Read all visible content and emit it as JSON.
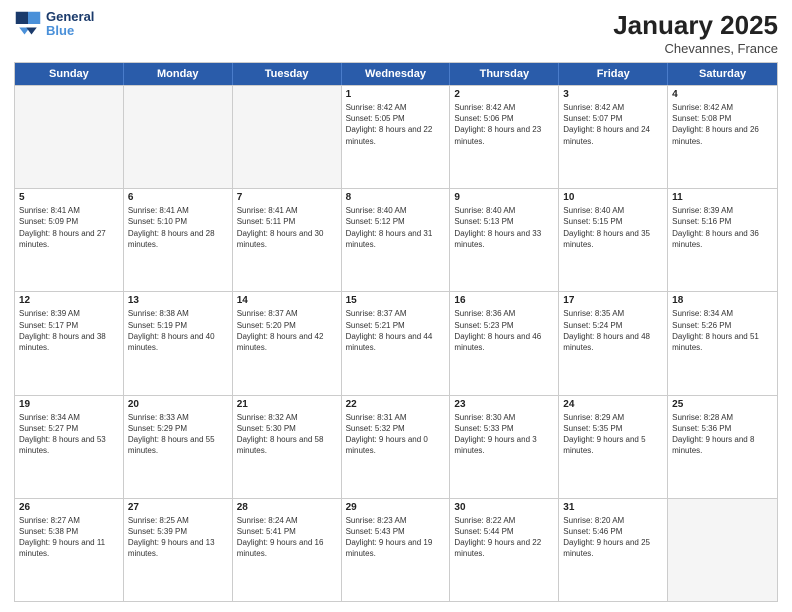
{
  "logo": {
    "line1": "General",
    "line2": "Blue"
  },
  "title": "January 2025",
  "location": "Chevannes, France",
  "days": [
    "Sunday",
    "Monday",
    "Tuesday",
    "Wednesday",
    "Thursday",
    "Friday",
    "Saturday"
  ],
  "weeks": [
    [
      {
        "day": "",
        "sunrise": "",
        "sunset": "",
        "daylight": ""
      },
      {
        "day": "",
        "sunrise": "",
        "sunset": "",
        "daylight": ""
      },
      {
        "day": "",
        "sunrise": "",
        "sunset": "",
        "daylight": ""
      },
      {
        "day": "1",
        "sunrise": "Sunrise: 8:42 AM",
        "sunset": "Sunset: 5:05 PM",
        "daylight": "Daylight: 8 hours and 22 minutes."
      },
      {
        "day": "2",
        "sunrise": "Sunrise: 8:42 AM",
        "sunset": "Sunset: 5:06 PM",
        "daylight": "Daylight: 8 hours and 23 minutes."
      },
      {
        "day": "3",
        "sunrise": "Sunrise: 8:42 AM",
        "sunset": "Sunset: 5:07 PM",
        "daylight": "Daylight: 8 hours and 24 minutes."
      },
      {
        "day": "4",
        "sunrise": "Sunrise: 8:42 AM",
        "sunset": "Sunset: 5:08 PM",
        "daylight": "Daylight: 8 hours and 26 minutes."
      }
    ],
    [
      {
        "day": "5",
        "sunrise": "Sunrise: 8:41 AM",
        "sunset": "Sunset: 5:09 PM",
        "daylight": "Daylight: 8 hours and 27 minutes."
      },
      {
        "day": "6",
        "sunrise": "Sunrise: 8:41 AM",
        "sunset": "Sunset: 5:10 PM",
        "daylight": "Daylight: 8 hours and 28 minutes."
      },
      {
        "day": "7",
        "sunrise": "Sunrise: 8:41 AM",
        "sunset": "Sunset: 5:11 PM",
        "daylight": "Daylight: 8 hours and 30 minutes."
      },
      {
        "day": "8",
        "sunrise": "Sunrise: 8:40 AM",
        "sunset": "Sunset: 5:12 PM",
        "daylight": "Daylight: 8 hours and 31 minutes."
      },
      {
        "day": "9",
        "sunrise": "Sunrise: 8:40 AM",
        "sunset": "Sunset: 5:13 PM",
        "daylight": "Daylight: 8 hours and 33 minutes."
      },
      {
        "day": "10",
        "sunrise": "Sunrise: 8:40 AM",
        "sunset": "Sunset: 5:15 PM",
        "daylight": "Daylight: 8 hours and 35 minutes."
      },
      {
        "day": "11",
        "sunrise": "Sunrise: 8:39 AM",
        "sunset": "Sunset: 5:16 PM",
        "daylight": "Daylight: 8 hours and 36 minutes."
      }
    ],
    [
      {
        "day": "12",
        "sunrise": "Sunrise: 8:39 AM",
        "sunset": "Sunset: 5:17 PM",
        "daylight": "Daylight: 8 hours and 38 minutes."
      },
      {
        "day": "13",
        "sunrise": "Sunrise: 8:38 AM",
        "sunset": "Sunset: 5:19 PM",
        "daylight": "Daylight: 8 hours and 40 minutes."
      },
      {
        "day": "14",
        "sunrise": "Sunrise: 8:37 AM",
        "sunset": "Sunset: 5:20 PM",
        "daylight": "Daylight: 8 hours and 42 minutes."
      },
      {
        "day": "15",
        "sunrise": "Sunrise: 8:37 AM",
        "sunset": "Sunset: 5:21 PM",
        "daylight": "Daylight: 8 hours and 44 minutes."
      },
      {
        "day": "16",
        "sunrise": "Sunrise: 8:36 AM",
        "sunset": "Sunset: 5:23 PM",
        "daylight": "Daylight: 8 hours and 46 minutes."
      },
      {
        "day": "17",
        "sunrise": "Sunrise: 8:35 AM",
        "sunset": "Sunset: 5:24 PM",
        "daylight": "Daylight: 8 hours and 48 minutes."
      },
      {
        "day": "18",
        "sunrise": "Sunrise: 8:34 AM",
        "sunset": "Sunset: 5:26 PM",
        "daylight": "Daylight: 8 hours and 51 minutes."
      }
    ],
    [
      {
        "day": "19",
        "sunrise": "Sunrise: 8:34 AM",
        "sunset": "Sunset: 5:27 PM",
        "daylight": "Daylight: 8 hours and 53 minutes."
      },
      {
        "day": "20",
        "sunrise": "Sunrise: 8:33 AM",
        "sunset": "Sunset: 5:29 PM",
        "daylight": "Daylight: 8 hours and 55 minutes."
      },
      {
        "day": "21",
        "sunrise": "Sunrise: 8:32 AM",
        "sunset": "Sunset: 5:30 PM",
        "daylight": "Daylight: 8 hours and 58 minutes."
      },
      {
        "day": "22",
        "sunrise": "Sunrise: 8:31 AM",
        "sunset": "Sunset: 5:32 PM",
        "daylight": "Daylight: 9 hours and 0 minutes."
      },
      {
        "day": "23",
        "sunrise": "Sunrise: 8:30 AM",
        "sunset": "Sunset: 5:33 PM",
        "daylight": "Daylight: 9 hours and 3 minutes."
      },
      {
        "day": "24",
        "sunrise": "Sunrise: 8:29 AM",
        "sunset": "Sunset: 5:35 PM",
        "daylight": "Daylight: 9 hours and 5 minutes."
      },
      {
        "day": "25",
        "sunrise": "Sunrise: 8:28 AM",
        "sunset": "Sunset: 5:36 PM",
        "daylight": "Daylight: 9 hours and 8 minutes."
      }
    ],
    [
      {
        "day": "26",
        "sunrise": "Sunrise: 8:27 AM",
        "sunset": "Sunset: 5:38 PM",
        "daylight": "Daylight: 9 hours and 11 minutes."
      },
      {
        "day": "27",
        "sunrise": "Sunrise: 8:25 AM",
        "sunset": "Sunset: 5:39 PM",
        "daylight": "Daylight: 9 hours and 13 minutes."
      },
      {
        "day": "28",
        "sunrise": "Sunrise: 8:24 AM",
        "sunset": "Sunset: 5:41 PM",
        "daylight": "Daylight: 9 hours and 16 minutes."
      },
      {
        "day": "29",
        "sunrise": "Sunrise: 8:23 AM",
        "sunset": "Sunset: 5:43 PM",
        "daylight": "Daylight: 9 hours and 19 minutes."
      },
      {
        "day": "30",
        "sunrise": "Sunrise: 8:22 AM",
        "sunset": "Sunset: 5:44 PM",
        "daylight": "Daylight: 9 hours and 22 minutes."
      },
      {
        "day": "31",
        "sunrise": "Sunrise: 8:20 AM",
        "sunset": "Sunset: 5:46 PM",
        "daylight": "Daylight: 9 hours and 25 minutes."
      },
      {
        "day": "",
        "sunrise": "",
        "sunset": "",
        "daylight": ""
      }
    ]
  ]
}
